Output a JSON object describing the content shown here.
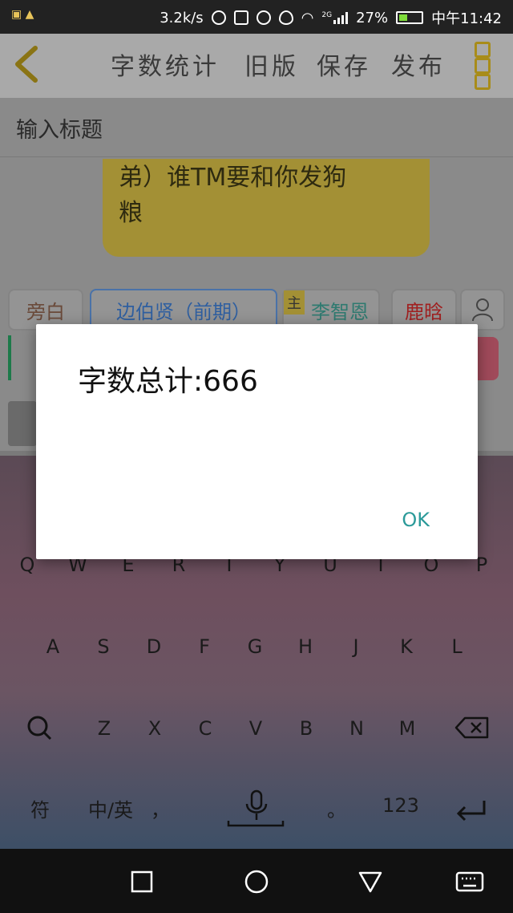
{
  "status_bar": {
    "net_speed": "3.2k/s",
    "network": "2G",
    "battery": "27%",
    "time": "中午11:42"
  },
  "app_bar": {
    "actions": [
      "字数统计",
      "旧版",
      "保存",
      "发布"
    ]
  },
  "editor": {
    "title_placeholder": "输入标题",
    "bubble_lines": [
      "弟）谁TM要和你发狗",
      "粮"
    ]
  },
  "roles": {
    "narration": "旁白",
    "character_1": "边伯贤（前期）",
    "main_tag": "主",
    "character_2": "李智恩",
    "character_3": "鹿晗"
  },
  "keyboard": {
    "row1": [
      "Q",
      "W",
      "E",
      "R",
      "T",
      "Y",
      "U",
      "I",
      "O",
      "P"
    ],
    "row2": [
      "A",
      "S",
      "D",
      "F",
      "G",
      "H",
      "J",
      "K",
      "L"
    ],
    "row3": [
      "Z",
      "X",
      "C",
      "V",
      "B",
      "N",
      "M"
    ],
    "bottom": {
      "symbols": "符",
      "lang": "中/英",
      "comma": "，",
      "period": "。",
      "numbers": "123"
    }
  },
  "dialog": {
    "message": "字数总计:666",
    "ok": "OK"
  },
  "colors": {
    "dialog_button": "#2b9a99",
    "accent_yellow": "#f0d04a"
  }
}
